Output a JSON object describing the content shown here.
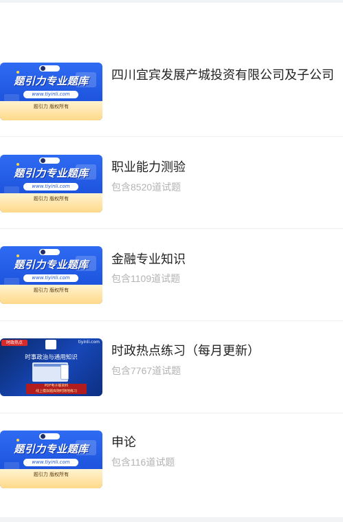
{
  "items": [
    {
      "title": "四川宜宾发展产城投资有限公司及子公司",
      "subtitle": "",
      "thumbnail": {
        "style": "blue",
        "headline": "题引力专业题库",
        "url": "www.tiyinli.com",
        "copyright": "题引力 版权所有"
      }
    },
    {
      "title": "职业能力测验",
      "subtitle": "包含8520道试题",
      "thumbnail": {
        "style": "blue",
        "headline": "题引力专业题库",
        "url": "www.tiyinli.com",
        "copyright": "题引力 版权所有"
      }
    },
    {
      "title": "金融专业知识",
      "subtitle": "包含1109道试题",
      "thumbnail": {
        "style": "blue",
        "headline": "题引力专业题库",
        "url": "www.tiyinli.com",
        "copyright": "题引力 版权所有"
      }
    },
    {
      "title": "时政热点练习（每月更新）",
      "subtitle": "包含7767道试题",
      "thumbnail": {
        "style": "news",
        "tag": "时政热点",
        "site": "tiyinli.com",
        "headline": "时事政治与通用知识",
        "promo_line1": "PDF电子版资料",
        "promo_line2": "线上模拟题库随时随地练习"
      }
    },
    {
      "title": "申论",
      "subtitle": "包含116道试题",
      "thumbnail": {
        "style": "blue",
        "headline": "题引力专业题库",
        "url": "www.tiyinli.com",
        "copyright": "题引力 版权所有"
      }
    }
  ],
  "colors": {
    "title": "#222222",
    "subtitle": "#b3b3b3",
    "thumb_blue": "#1f56e0",
    "thumb_gold": "#ffd98a",
    "news_red": "#d62b2b",
    "divider": "#eeeeee",
    "band": "#f2f3f5"
  }
}
